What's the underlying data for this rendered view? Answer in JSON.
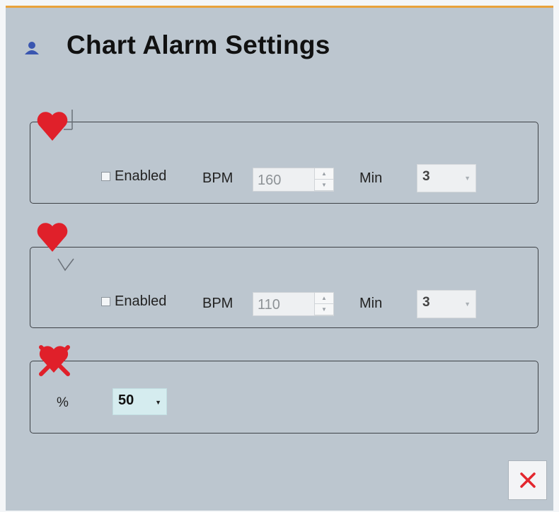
{
  "dialog": {
    "title": "Chart Alarm Settings"
  },
  "high_alarm": {
    "icon": "heart-up-icon",
    "enabled_label": "Enabled",
    "enabled": false,
    "bpm_label": "BPM",
    "bpm_value": "160",
    "min_label": "Min",
    "min_value": "3"
  },
  "low_alarm": {
    "icon": "heart-down-icon",
    "enabled_label": "Enabled",
    "enabled": false,
    "bpm_label": "BPM",
    "bpm_value": "110",
    "min_label": "Min",
    "min_value": "3"
  },
  "signal_loss": {
    "icon": "heart-crossed-icon",
    "percent_label": "%",
    "percent_value": "50"
  },
  "actions": {
    "close_icon": "close-icon"
  },
  "colors": {
    "accent": "#e9a23b",
    "heart": "#e0202a",
    "close": "#e3262e",
    "panel": "#bcc6cf"
  }
}
